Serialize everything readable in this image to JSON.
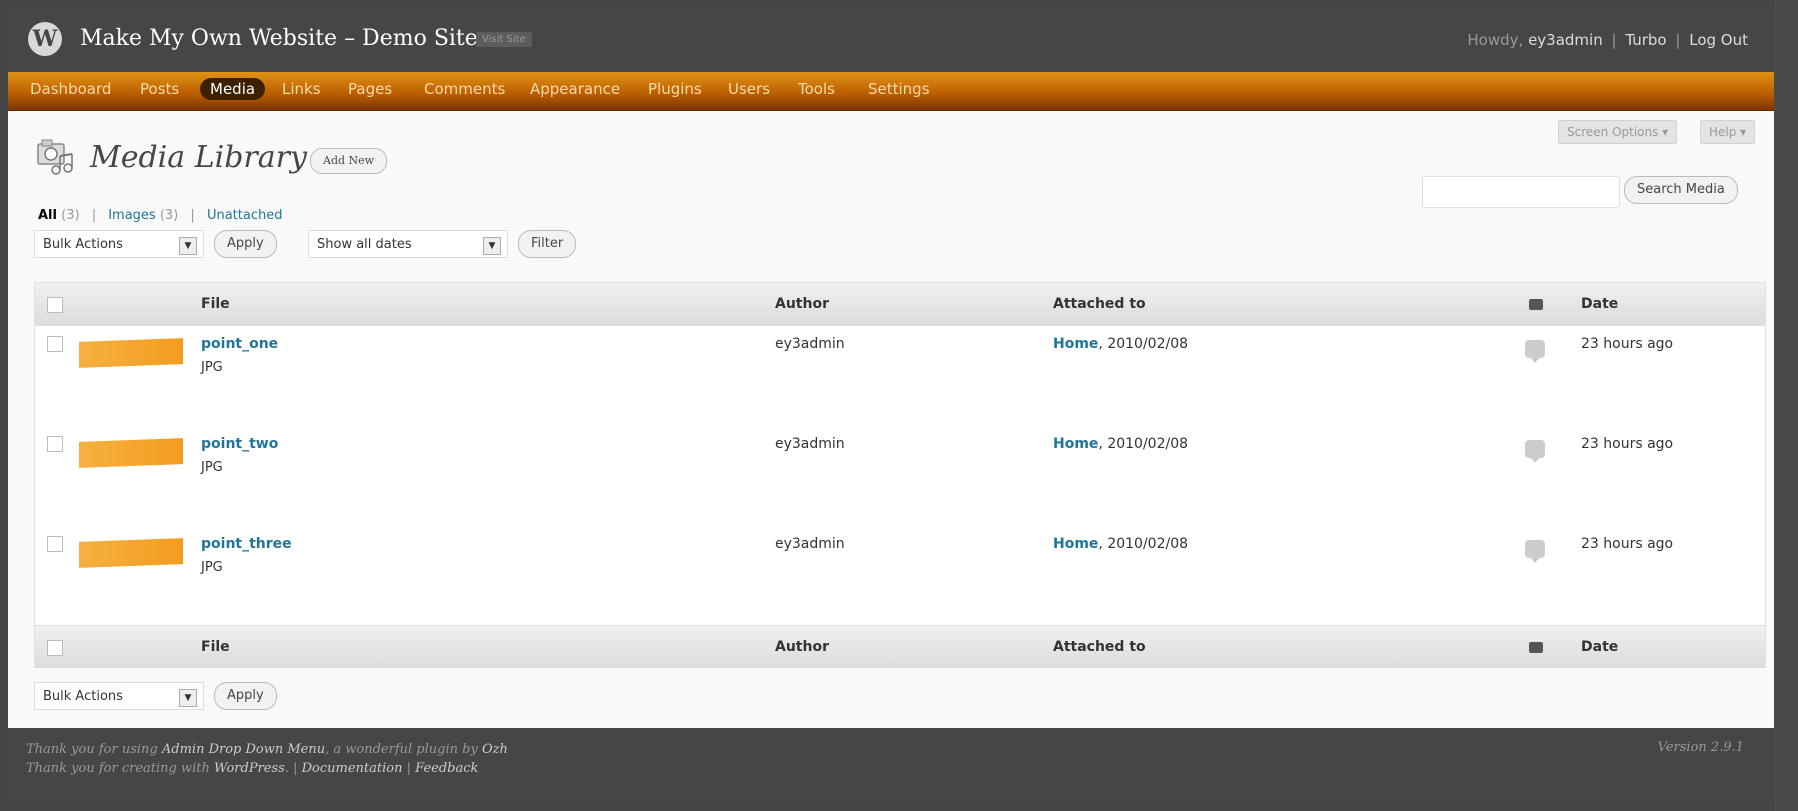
{
  "header": {
    "site_title": "Make My Own Website – Demo Site",
    "visit_site": "Visit Site",
    "howdy": "Howdy,",
    "user": "ey3admin",
    "turbo": "Turbo",
    "logout": "Log Out",
    "sep": "|"
  },
  "nav": [
    {
      "label": "Dashboard"
    },
    {
      "label": "Posts"
    },
    {
      "label": "Media"
    },
    {
      "label": "Links"
    },
    {
      "label": "Pages"
    },
    {
      "label": "Comments"
    },
    {
      "label": "Appearance"
    },
    {
      "label": "Plugins"
    },
    {
      "label": "Users"
    },
    {
      "label": "Tools"
    },
    {
      "label": "Settings"
    }
  ],
  "screen_options": "Screen Options ▾",
  "help": "Help ▾",
  "page": {
    "title": "Media Library",
    "add_new": "Add New"
  },
  "filters": {
    "all": "All",
    "all_count": "(3)",
    "images": "Images",
    "images_count": "(3)",
    "unattached": "Unattached",
    "sep": "|"
  },
  "search": {
    "value": "",
    "button": "Search Media"
  },
  "bulk": {
    "actions": "Bulk Actions",
    "apply": "Apply",
    "dates": "Show all dates",
    "filter": "Filter"
  },
  "table": {
    "headers": {
      "file": "File",
      "author": "Author",
      "attached": "Attached to",
      "date": "Date"
    },
    "rows": [
      {
        "file": "point_one",
        "type": "JPG",
        "author": "ey3admin",
        "attached_link": "Home",
        "attached_date": ", 2010/02/08",
        "comments": "0",
        "date": "23 hours ago"
      },
      {
        "file": "point_two",
        "type": "JPG",
        "author": "ey3admin",
        "attached_link": "Home",
        "attached_date": ", 2010/02/08",
        "comments": "0",
        "date": "23 hours ago"
      },
      {
        "file": "point_three",
        "type": "JPG",
        "author": "ey3admin",
        "attached_link": "Home",
        "attached_date": ", 2010/02/08",
        "comments": "0",
        "date": "23 hours ago"
      }
    ]
  },
  "footer": {
    "line1_a": "Thank you for using ",
    "line1_link": "Admin Drop Down Menu",
    "line1_b": ", a wonderful plugin by ",
    "line1_author": "Ozh",
    "line2_a": "Thank you for creating with ",
    "line2_link": "WordPress",
    "line2_b": ". | ",
    "documentation": "Documentation",
    "sep": " | ",
    "feedback": "Feedback",
    "version": "Version 2.9.1"
  },
  "colors": {
    "accent": "#d54e21",
    "link": "#21759b",
    "nav_orange": "#e09316",
    "header": "#464646"
  }
}
